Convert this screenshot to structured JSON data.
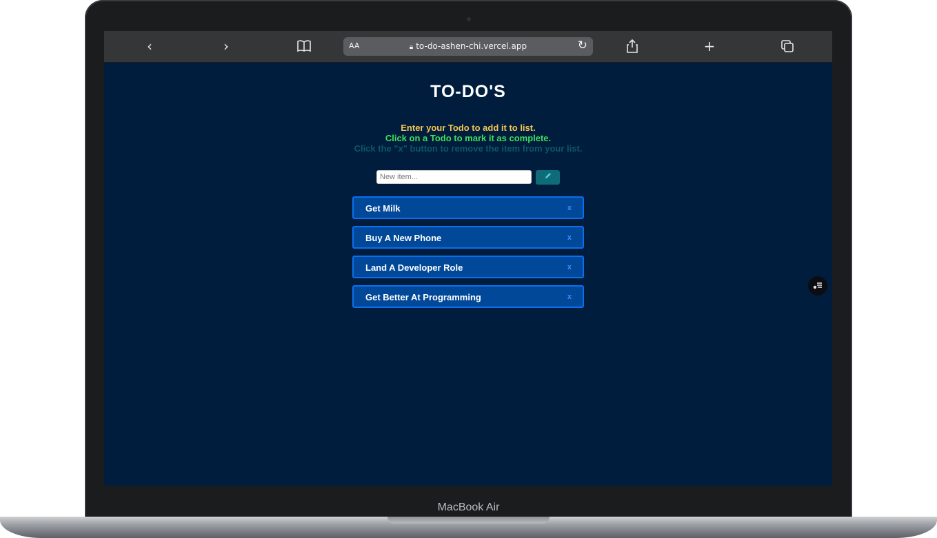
{
  "device": {
    "label": "MacBook Air"
  },
  "browser": {
    "back_icon": "chevron-left-icon",
    "forward_icon": "chevron-right-icon",
    "bookmarks_icon": "book-icon",
    "reader_label": "AA",
    "url": "to-do-ashen-chi.vercel.app",
    "lock_icon": "lock-icon",
    "reload_icon": "reload-icon",
    "share_icon": "share-icon",
    "new_tab_icon": "plus-icon",
    "tabs_icon": "tabs-icon"
  },
  "app": {
    "title": "TO-DO'S",
    "instructions": [
      {
        "text": "Enter your Todo to add it to list.",
        "color": "#f5c654"
      },
      {
        "text": "Click on a Todo to mark it as complete.",
        "color": "#3fe05e"
      },
      {
        "text": "Click the \"x\" button to remove the item from your list.",
        "color": "#0c5868"
      }
    ],
    "input": {
      "placeholder": "New item...",
      "value": ""
    },
    "add_button_icon": "pencil-icon",
    "todos": [
      {
        "label": "Get Milk",
        "remove": "x"
      },
      {
        "label": "Buy A New Phone",
        "remove": "x"
      },
      {
        "label": "Land A Developer Role",
        "remove": "x"
      },
      {
        "label": "Get Better At Programming",
        "remove": "x"
      }
    ],
    "floating_icon": "menu-icon"
  },
  "colors": {
    "page_bg": "#001d3d",
    "item_bg": "#014898",
    "item_border": "#0b6ff0",
    "add_button": "#0f6b78"
  }
}
